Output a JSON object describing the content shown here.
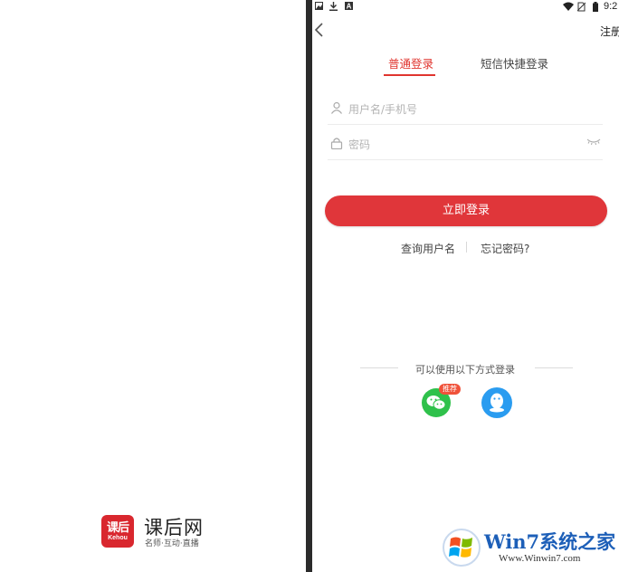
{
  "splash": {
    "logo_cn": "课后",
    "logo_en": "Kehou",
    "brand_name": "课后网",
    "slogan": "名师·互动·直播",
    "brand_color": "#d9272e"
  },
  "status_bar": {
    "time": "9:2",
    "icons": [
      "image-icon",
      "download-icon",
      "a-icon",
      "wifi-icon",
      "no-sim-icon",
      "battery-icon"
    ]
  },
  "header": {
    "register_label": "注册"
  },
  "tabs": [
    {
      "label": "普通登录",
      "active": true
    },
    {
      "label": "短信快捷登录",
      "active": false
    }
  ],
  "form": {
    "username_placeholder": "用户名/手机号",
    "password_placeholder": "密码"
  },
  "login_button": {
    "label": "立即登录",
    "color": "#e0363a"
  },
  "links": {
    "query_username": "查询用户名",
    "forgot_password": "忘记密码?"
  },
  "other_login": {
    "title": "可以使用以下方式登录",
    "recommend_badge": "推荐",
    "wechat_color": "#2fc14b",
    "qq_color": "#2a9cf0"
  },
  "watermark": {
    "title": "Win7系统之家",
    "url": "Www.Winwin7.com"
  },
  "accent_color": "#e0352f"
}
